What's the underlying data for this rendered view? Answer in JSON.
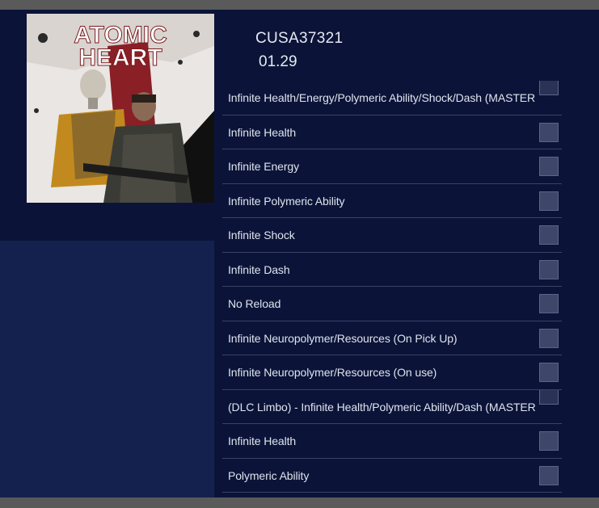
{
  "game": {
    "cover_art_text_line1": "ATOMIC",
    "cover_art_text_line2": "HEART",
    "title_id": "CUSA37321",
    "version": "01.29"
  },
  "cheats": [
    {
      "label": "Infinite Health/Energy/Polymeric Ability/Shock/Dash (MASTER",
      "master": true,
      "checked": false
    },
    {
      "label": "Infinite Health",
      "master": false,
      "checked": false
    },
    {
      "label": "Infinite Energy",
      "master": false,
      "checked": false
    },
    {
      "label": "Infinite Polymeric Ability",
      "master": false,
      "checked": false
    },
    {
      "label": "Infinite Shock",
      "master": false,
      "checked": false
    },
    {
      "label": "Infinite Dash",
      "master": false,
      "checked": false
    },
    {
      "label": "No Reload",
      "master": false,
      "checked": false
    },
    {
      "label": "Infinite Neuropolymer/Resources (On Pick Up)",
      "master": false,
      "checked": false
    },
    {
      "label": "Infinite Neuropolymer/Resources (On use)",
      "master": false,
      "checked": false
    },
    {
      "label": "(DLC Limbo) - Infinite Health/Polymeric Ability/Dash (MASTER",
      "master": true,
      "checked": false
    },
    {
      "label": "Infinite Health",
      "master": false,
      "checked": false
    },
    {
      "label": "Polymeric Ability",
      "master": false,
      "checked": false
    }
  ],
  "colors": {
    "background": "#0b1438",
    "left_panel_lower": "#14214e",
    "checkbox": "#3e4769",
    "text": "#dfe3ee"
  }
}
